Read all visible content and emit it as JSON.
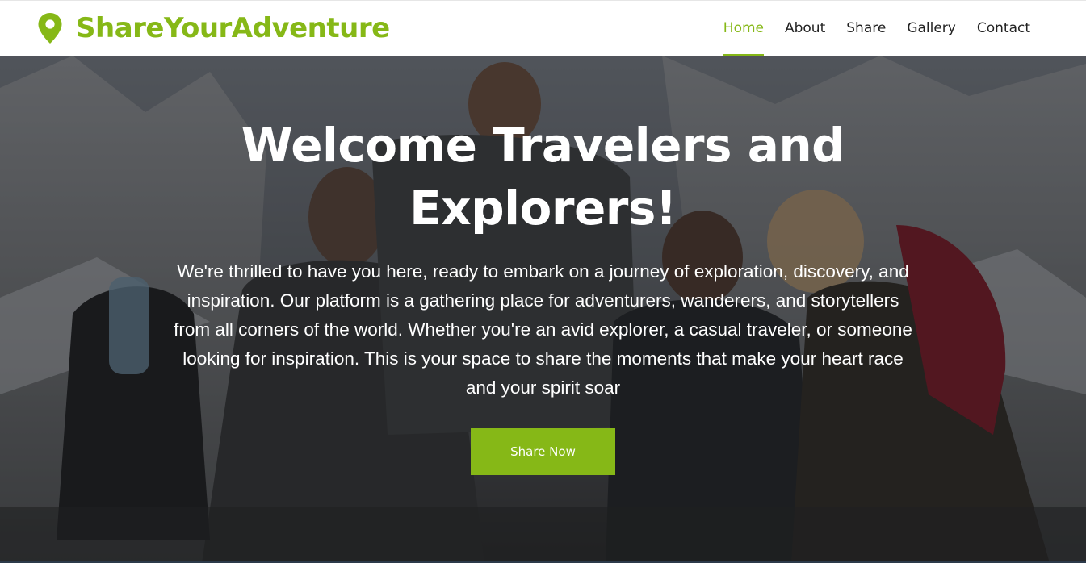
{
  "brand": {
    "name": "ShareYourAdventure",
    "icon": "map-pin-icon",
    "color": "#86B817"
  },
  "nav": {
    "items": [
      {
        "label": "Home",
        "active": true
      },
      {
        "label": "About",
        "active": false
      },
      {
        "label": "Share",
        "active": false
      },
      {
        "label": "Gallery",
        "active": false
      },
      {
        "label": "Contact",
        "active": false
      }
    ]
  },
  "hero": {
    "title": "Welcome Travelers and Explorers!",
    "text": "We're thrilled to have you here, ready to embark on a journey of exploration, discovery, and inspiration. Our platform is a gathering place for adventurers, wanderers, and storytellers from all corners of the world. Whether you're an avid explorer, a casual traveler, or someone looking for inspiration. This is your space to share the moments that make your heart race and your spirit soar",
    "button_label": "Share Now",
    "background": "photo of a group of laughing hikers with backpacks in front of mountains"
  },
  "colors": {
    "accent": "#86B817",
    "text_dark": "#222222",
    "hero_text": "#FFFFFF"
  }
}
